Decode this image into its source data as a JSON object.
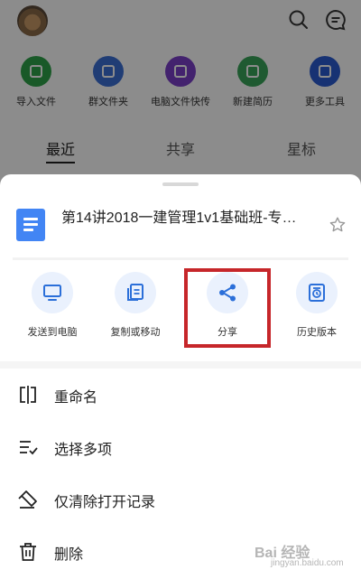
{
  "background": {
    "tools": [
      {
        "label": "导入文件",
        "color": "#2fa34a"
      },
      {
        "label": "群文件夹",
        "color": "#3b6fd6"
      },
      {
        "label": "电脑文件快传",
        "color": "#7a3fc9"
      },
      {
        "label": "新建简历",
        "color": "#3aa55a"
      },
      {
        "label": "更多工具",
        "color": "#2b5bd1"
      }
    ],
    "tabs": [
      "最近",
      "共享",
      "星标"
    ]
  },
  "sheet": {
    "file_title": "第14讲2018一建管理1v1基础班-专…",
    "actions": [
      {
        "label": "发送到电脑",
        "icon": "monitor-icon"
      },
      {
        "label": "复制或移动",
        "icon": "copy-icon"
      },
      {
        "label": "分享",
        "icon": "share-icon"
      },
      {
        "label": "历史版本",
        "icon": "history-icon"
      }
    ],
    "menu": [
      {
        "label": "重命名",
        "icon": "rename-icon"
      },
      {
        "label": "选择多项",
        "icon": "multi-select-icon"
      },
      {
        "label": "仅清除打开记录",
        "icon": "eraser-icon"
      },
      {
        "label": "删除",
        "icon": "trash-icon"
      }
    ]
  },
  "watermark": {
    "brand": "Bai 经验",
    "url": "jingyan.baidu.com"
  },
  "colors": {
    "accent": "#2b6fd9",
    "highlight": "#c6262a",
    "doc": "#4285f4"
  }
}
